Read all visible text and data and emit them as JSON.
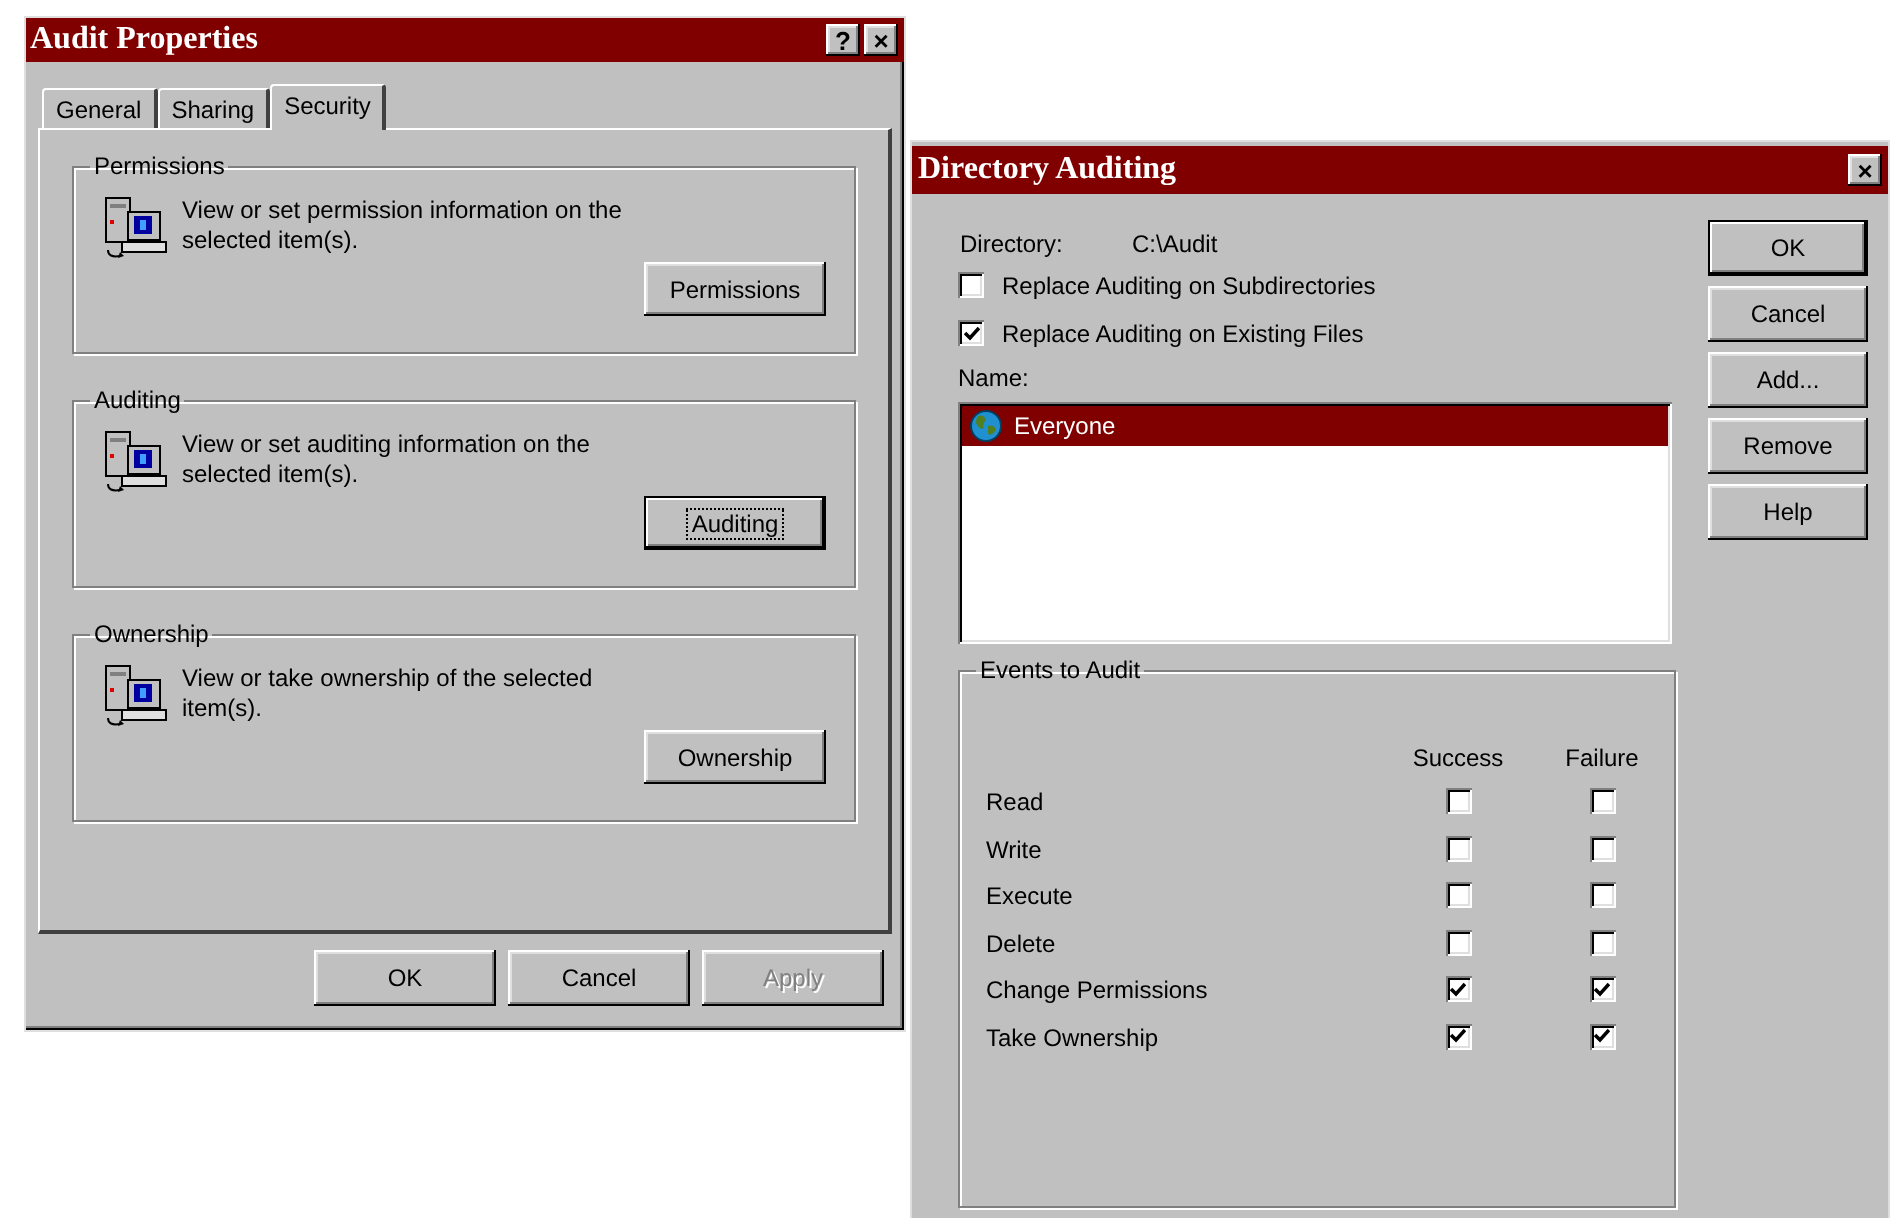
{
  "left_window": {
    "title": "Audit Properties",
    "title_buttons": [
      "?",
      "×"
    ],
    "tabs": [
      {
        "label": "General",
        "selected": false
      },
      {
        "label": "Sharing",
        "selected": false
      },
      {
        "label": "Security",
        "selected": true
      }
    ],
    "groups": [
      {
        "title": "Permissions",
        "description": "View or set permission information on the selected item(s).",
        "button": "Permissions",
        "focused": false
      },
      {
        "title": "Auditing",
        "description": "View or set auditing information on the selected item(s).",
        "button": "Auditing",
        "focused": true
      },
      {
        "title": "Ownership",
        "description": "View or take ownership of the selected item(s).",
        "button": "Ownership",
        "focused": false
      }
    ],
    "buttons": [
      {
        "label": "OK",
        "disabled": false
      },
      {
        "label": "Cancel",
        "disabled": false
      },
      {
        "label": "Apply",
        "disabled": true
      }
    ]
  },
  "right_window": {
    "title": "Directory Auditing",
    "close": "×",
    "directory_label": "Directory:",
    "directory_value": "C:\\Audit",
    "options": [
      {
        "label": "Replace Auditing on Subdirectories",
        "checked": false
      },
      {
        "label": "Replace Auditing on Existing Files",
        "checked": true
      }
    ],
    "name_label": "Name:",
    "names": [
      {
        "label": "Everyone",
        "selected": true
      }
    ],
    "events": {
      "title": "Events to Audit",
      "columns": [
        "Success",
        "Failure"
      ],
      "rows": [
        {
          "label": "Read",
          "success": false,
          "failure": false
        },
        {
          "label": "Write",
          "success": false,
          "failure": false
        },
        {
          "label": "Execute",
          "success": false,
          "failure": false
        },
        {
          "label": "Delete",
          "success": false,
          "failure": false
        },
        {
          "label": "Change Permissions",
          "success": true,
          "failure": true
        },
        {
          "label": "Take Ownership",
          "success": true,
          "failure": true
        }
      ]
    },
    "buttons": [
      "OK",
      "Cancel",
      "Add...",
      "Remove",
      "Help"
    ]
  }
}
